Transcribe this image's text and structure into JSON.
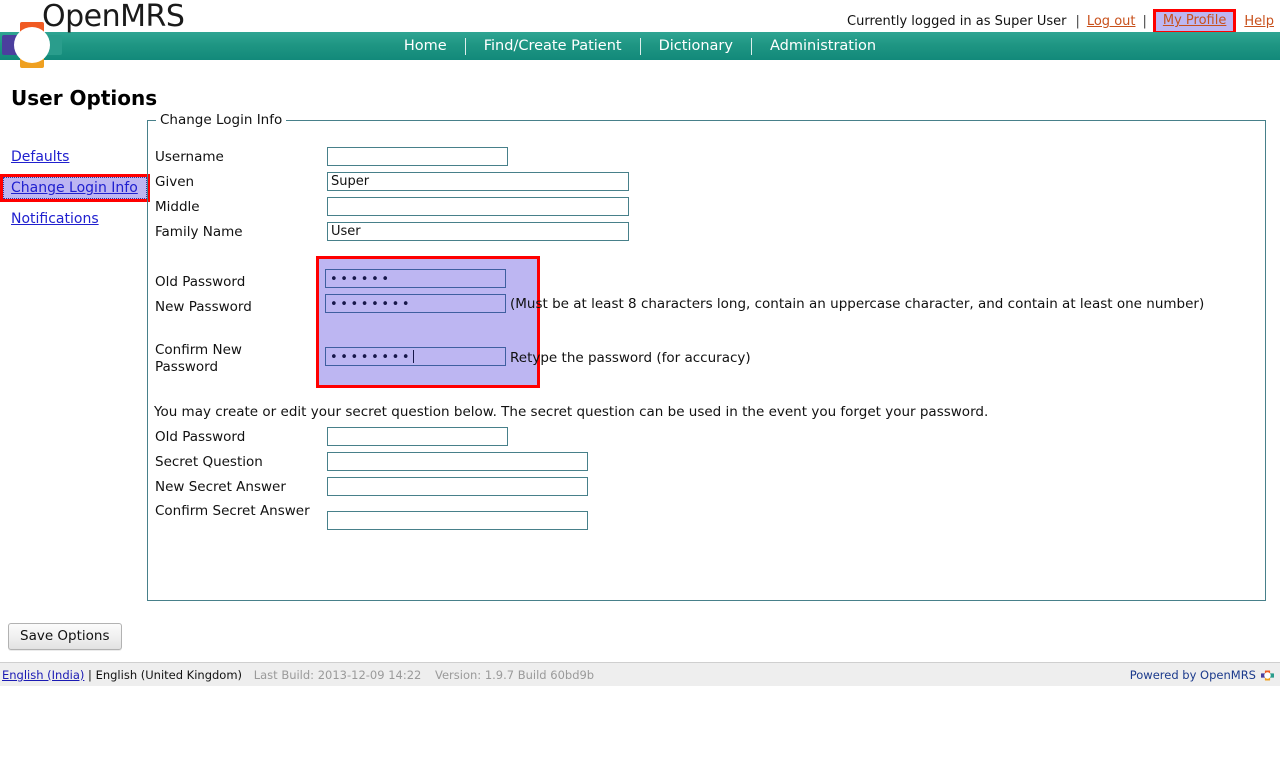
{
  "app": {
    "brand": "OpenMRS",
    "logo_icon": "openmrs-cross-logo",
    "colors": {
      "navbar_teal": "#1f9683",
      "link_blue": "#2020cf",
      "header_link_orange": "#c8501b",
      "highlight_lavender": "#bdb6f2",
      "highlight_red": "#ff0000",
      "field_border_teal": "#47808a"
    }
  },
  "userbar": {
    "logged_in_text": "Currently logged in as Super User",
    "separator": "|",
    "logout_label": "Log out",
    "my_profile_label": "My Profile",
    "help_label": "Help"
  },
  "nav": {
    "items": [
      {
        "label": "Home"
      },
      {
        "label": "Find/Create Patient"
      },
      {
        "label": "Dictionary"
      },
      {
        "label": "Administration"
      }
    ]
  },
  "page": {
    "title": "User Options"
  },
  "sidebar": {
    "items": [
      {
        "label": "Defaults",
        "active": false
      },
      {
        "label": "Change Login Info",
        "active": true
      },
      {
        "label": "Notifications",
        "active": false
      }
    ]
  },
  "form": {
    "legend": "Change Login Info",
    "fields": {
      "username": {
        "label": "Username",
        "value": "",
        "placeholder": ""
      },
      "given": {
        "label": "Given",
        "value": "Super",
        "placeholder": ""
      },
      "middle": {
        "label": "Middle",
        "value": "",
        "placeholder": ""
      },
      "family_name": {
        "label": "Family Name",
        "value": "User",
        "placeholder": ""
      }
    },
    "password_section": {
      "old_password": {
        "label": "Old Password",
        "masked_value": "••••••",
        "char_count": 6
      },
      "new_password": {
        "label": "New Password",
        "masked_value": "••••••••",
        "char_count": 8
      },
      "confirm_new_password": {
        "label": "Confirm New Password",
        "masked_value": "••••••••",
        "char_count": 8
      },
      "new_password_hint": "(Must be at least 8 characters long, contain an uppercase character, and contain at least one number)",
      "confirm_hint": "Retype the password (for accuracy)"
    },
    "secret_section": {
      "note": "You may create or edit your secret question below. The secret question can be used in the event you forget your password.",
      "old_password": {
        "label": "Old Password",
        "value": "",
        "placeholder": ""
      },
      "secret_question": {
        "label": "Secret Question",
        "value": "",
        "placeholder": ""
      },
      "new_secret_answer": {
        "label": "New Secret Answer",
        "value": "",
        "placeholder": ""
      },
      "confirm_secret_answer": {
        "label": "Confirm Secret Answer",
        "value": "",
        "placeholder": ""
      }
    },
    "save_label": "Save Options"
  },
  "footer": {
    "locale_current": "English (India)",
    "locale_separator": "|",
    "locale_other": "English (United Kingdom)",
    "last_build": "Last Build: 2013-12-09 14:22",
    "version": "Version: 1.9.7 Build 60bd9b",
    "powered_by": "Powered by OpenMRS",
    "powered_by_icon": "openmrs-mini-logo"
  }
}
